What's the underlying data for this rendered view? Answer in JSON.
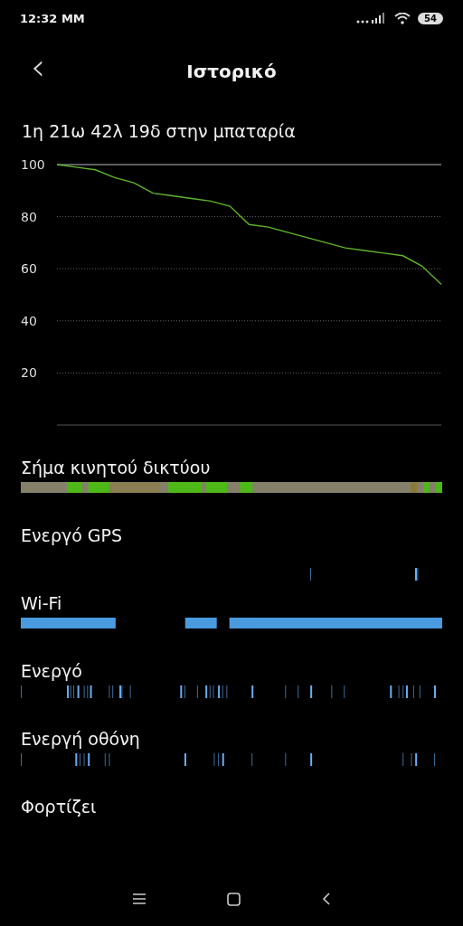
{
  "status_bar": {
    "time": "12:32 MM",
    "battery": "54"
  },
  "header": {
    "back": "‹",
    "title": "Ιστορικό"
  },
  "summary": "1η 21ω 42λ 19δ στην μπαταρία",
  "battery_chart": {
    "chart_data": {
      "type": "line",
      "ylim": [
        0,
        100
      ],
      "yticks": [
        20,
        40,
        60,
        80,
        100
      ],
      "grid": true,
      "series": [
        {
          "color": "#5fb52a",
          "values": [
            100,
            99,
            98,
            95,
            93,
            89,
            88,
            87,
            86,
            84,
            77,
            76,
            74,
            72,
            70,
            68,
            67,
            66,
            65,
            61,
            54
          ]
        }
      ]
    }
  },
  "tracks": [
    {
      "label": "Σήμα κινητού δικτύου",
      "kind": "signal"
    },
    {
      "label": "Ενεργό GPS",
      "kind": "gps"
    },
    {
      "label": "Wi-Fi",
      "kind": "wifi"
    },
    {
      "label": "Ενεργό",
      "kind": "awake"
    },
    {
      "label": "Ενεργή οθόνη",
      "kind": "screen"
    },
    {
      "label": "Φορτίζει",
      "kind": "charging"
    }
  ]
}
